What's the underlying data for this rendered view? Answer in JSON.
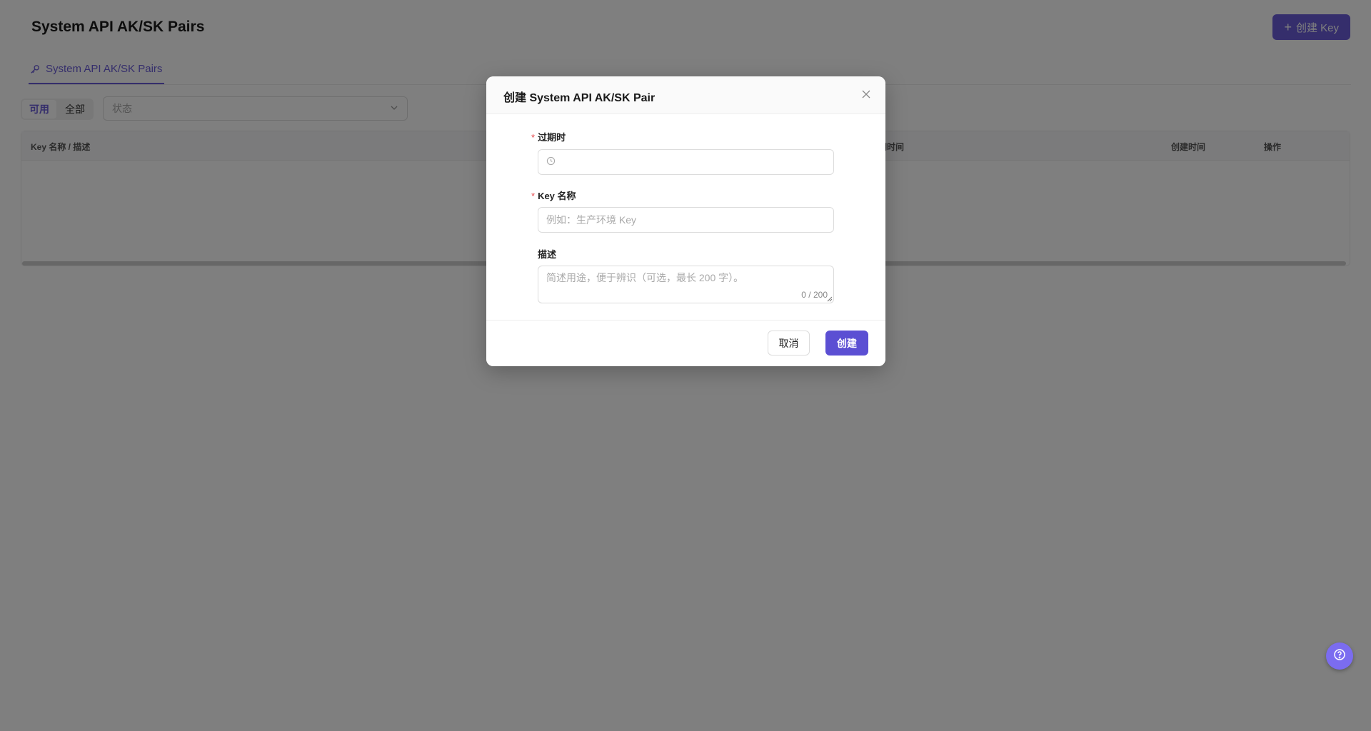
{
  "page": {
    "title": "System API AK/SK Pairs",
    "create_button_label": "创建 Key"
  },
  "tabs": [
    {
      "label": "System API AK/SK Pairs",
      "icon": "key-icon",
      "active": true
    }
  ],
  "filters": {
    "segments": [
      {
        "label": "可用",
        "selected": true
      },
      {
        "label": "全部",
        "selected": false
      }
    ],
    "status_placeholder": "状态"
  },
  "table": {
    "columns": [
      "Key 名称 / 描述",
      "期时间",
      "创建时间",
      "操作"
    ],
    "rows": []
  },
  "modal": {
    "title": "创建 System API AK/SK Pair",
    "fields": {
      "expiry": {
        "label": "过期时",
        "required": true,
        "value": ""
      },
      "name": {
        "label": "Key 名称",
        "required": true,
        "placeholder": "例如：生产环境 Key"
      },
      "description": {
        "label": "描述",
        "required": false,
        "placeholder": "简述用途，便于辨识（可选，最长 200 字）。",
        "counter": "0 / 200"
      }
    },
    "cancel_label": "取消",
    "submit_label": "创建"
  },
  "colors": {
    "accent": "#6a5cd8",
    "required": "#e5484d",
    "help_button": "#7b6cf0"
  }
}
